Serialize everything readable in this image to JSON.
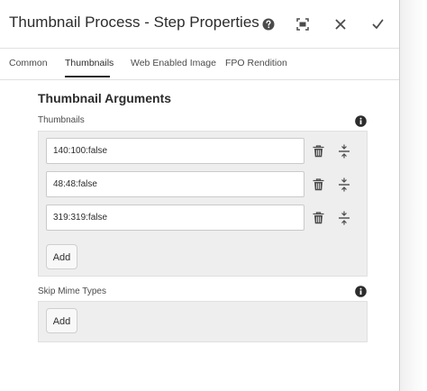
{
  "dialog": {
    "title": "Thumbnail Process - Step Properties",
    "header_icons": [
      "help-icon",
      "fullscreen-icon",
      "close-icon",
      "done-icon"
    ]
  },
  "tabs": [
    {
      "label": "Common"
    },
    {
      "label": "Thumbnails",
      "active": true
    },
    {
      "label": "Web Enabled Image"
    },
    {
      "label": "FPO Rendition"
    }
  ],
  "section": {
    "title": "Thumbnail Arguments"
  },
  "thumbnails": {
    "label": "Thumbnails",
    "items": [
      {
        "value": "140:100:false"
      },
      {
        "value": "48:48:false"
      },
      {
        "value": "319:319:false"
      }
    ],
    "add_label": "Add"
  },
  "skip_mime_types": {
    "label": "Skip Mime Types",
    "add_label": "Add"
  },
  "colors": {
    "text": "#2c2c2c",
    "panel_bg": "#eeeeee",
    "border": "#cacaca"
  }
}
